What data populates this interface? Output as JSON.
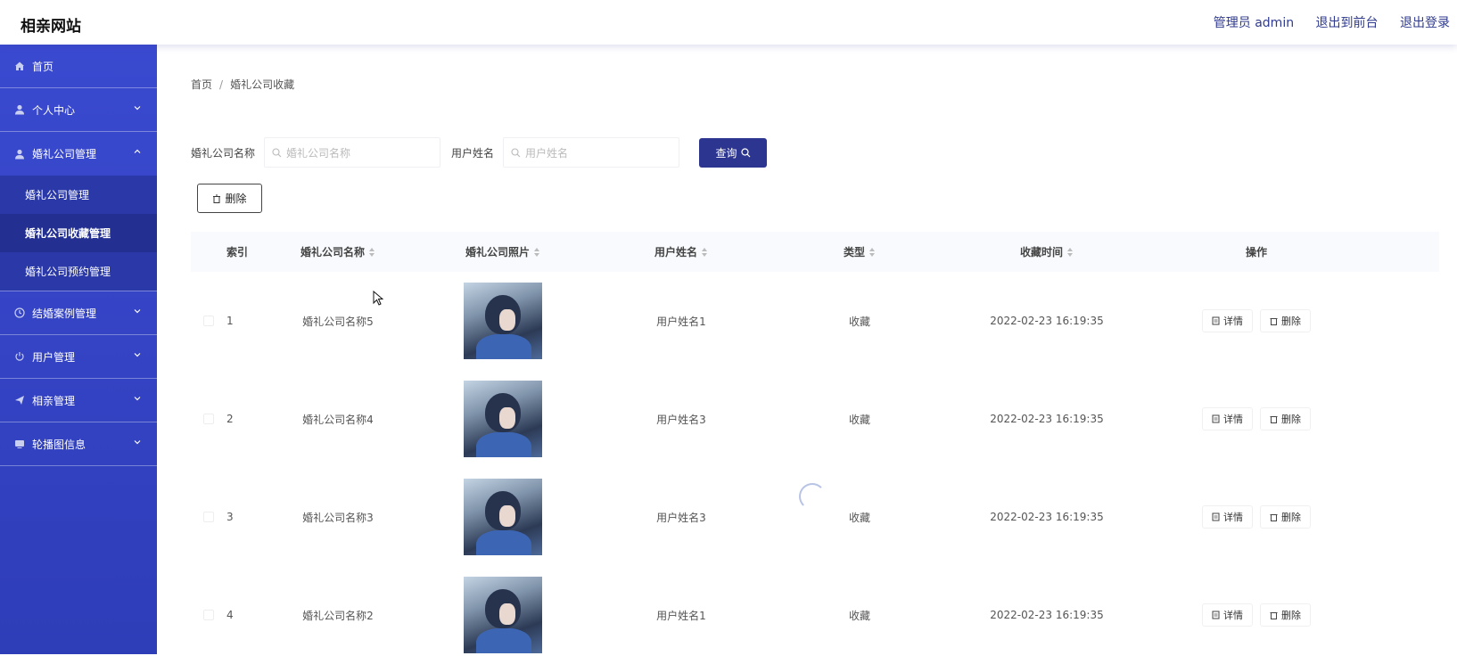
{
  "header": {
    "brand": "相亲网站",
    "admin_label": "管理员 admin",
    "to_front": "退出到前台",
    "logout": "退出登录"
  },
  "sidebar": {
    "items": [
      {
        "label": "首页",
        "icon": "home-icon"
      },
      {
        "label": "个人中心",
        "icon": "user-icon"
      },
      {
        "label": "婚礼公司管理",
        "icon": "user-icon",
        "expanded": true,
        "children": [
          "婚礼公司管理",
          "婚礼公司收藏管理",
          "婚礼公司预约管理"
        ]
      },
      {
        "label": "结婚案例管理",
        "icon": "clock-icon"
      },
      {
        "label": "用户管理",
        "icon": "power-icon"
      },
      {
        "label": "相亲管理",
        "icon": "send-icon"
      },
      {
        "label": "轮播图信息",
        "icon": "monitor-icon"
      }
    ],
    "active_child": "婚礼公司收藏管理"
  },
  "breadcrumb": {
    "home": "首页",
    "sep": "/",
    "current": "婚礼公司收藏"
  },
  "search": {
    "company_label": "婚礼公司名称",
    "company_placeholder": "婚礼公司名称",
    "user_label": "用户姓名",
    "user_placeholder": "用户姓名",
    "query_button": "查询"
  },
  "toolbar": {
    "delete_label": "删除"
  },
  "table": {
    "columns": [
      "索引",
      "婚礼公司名称",
      "婚礼公司照片",
      "用户姓名",
      "类型",
      "收藏时间",
      "操作"
    ],
    "rows": [
      {
        "index": "1",
        "company": "婚礼公司名称5",
        "user": "用户姓名1",
        "type": "收藏",
        "time": "2022-02-23 16:19:35"
      },
      {
        "index": "2",
        "company": "婚礼公司名称4",
        "user": "用户姓名3",
        "type": "收藏",
        "time": "2022-02-23 16:19:35"
      },
      {
        "index": "3",
        "company": "婚礼公司名称3",
        "user": "用户姓名3",
        "type": "收藏",
        "time": "2022-02-23 16:19:35"
      },
      {
        "index": "4",
        "company": "婚礼公司名称2",
        "user": "用户姓名1",
        "type": "收藏",
        "time": "2022-02-23 16:19:35"
      }
    ],
    "detail_label": "详情",
    "row_delete_label": "删除"
  },
  "colors": {
    "sidebar": "#3a4ad0",
    "primary": "#2c3590",
    "header_text": "#2f3a8f"
  }
}
